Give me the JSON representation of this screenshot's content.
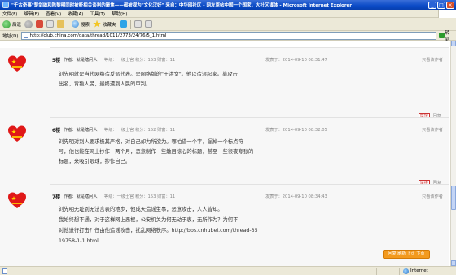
{
  "window": {
    "title": "\"千古奇事\"楚剑雄和陈黎明同时被贬相关谈判的聚焦——都被视为\"文化汉奸\" 来自：中华网社区 - 网友原帖中国一个国家，大社区媒体 - Microsoft Internet Explorer"
  },
  "menu": [
    "文件(F)",
    "编辑(E)",
    "查看(V)",
    "收藏(A)",
    "工具(T)",
    "帮助(H)"
  ],
  "toolbar": {
    "back": "后退",
    "search": "搜索",
    "favorites": "收藏夹"
  },
  "address": {
    "label": "地址(D)",
    "url": "http://club.china.com/data/thread/1011/2773/24/76/5_1.html",
    "go": "转到"
  },
  "posts": [
    {
      "floor": "5楼",
      "author": "作者：就是瞎问人",
      "stats": "等级：一级士官    积分：153    财富：11",
      "date": "发表于：2014-09-10 08:31:47",
      "ops": "只看该作者",
      "body": [
        "刘先明就是当代网络造反派代表。是网络版的\"王洪文\"。他以造混起家。靠攻击",
        "出名，背叛人民，最终遭到人民的审判。"
      ],
      "report": "举报",
      "reply": "回复"
    },
    {
      "floor": "6楼",
      "author": "作者：就是瞎问人",
      "stats": "等级：一级士官    积分：152    财富：11",
      "date": "发表于：2014-09-10 08:32:05",
      "ops": "只看该作者",
      "body": [
        "刘先明对别人要求极其严格，对自己却为所欲为。哪怕借一个字，漏掉一个标点符",
        "号，他也能在网上抄作一两个月，恶意制作一些触目惊心的标题，甚至一些很夜夸张的",
        "标题，来吸引眼球，抄作自己。"
      ],
      "report": "举报",
      "reply": "回复"
    },
    {
      "floor": "7楼",
      "author": "作者：就是瞎问人",
      "stats": "等级：一级士官    积分：153    财富：11",
      "date": "发表于：2014-09-10 08:34:43",
      "ops": "只看该作者",
      "body": [
        "刘先明无耻到无法言表的地步，他成天造谣生事，恶意攻击，人人皆知。",
        "我始终想不通，对于这样网上恶棍，公安机关为何无动于衷，无所作为？为何不",
        "对他进行打击？任由他造谣攻击，扰乱网络秩序。http://bbs.cnhubei.com/thread-35",
        "19758-1-1.html"
      ]
    }
  ],
  "float_button": "回复  刷新  上页  下页",
  "status": {
    "zone": "Internet"
  },
  "colors": {
    "accent": "#0a4ac6",
    "avatar_red": "#e01818",
    "float_orange": "#f39a1e"
  }
}
